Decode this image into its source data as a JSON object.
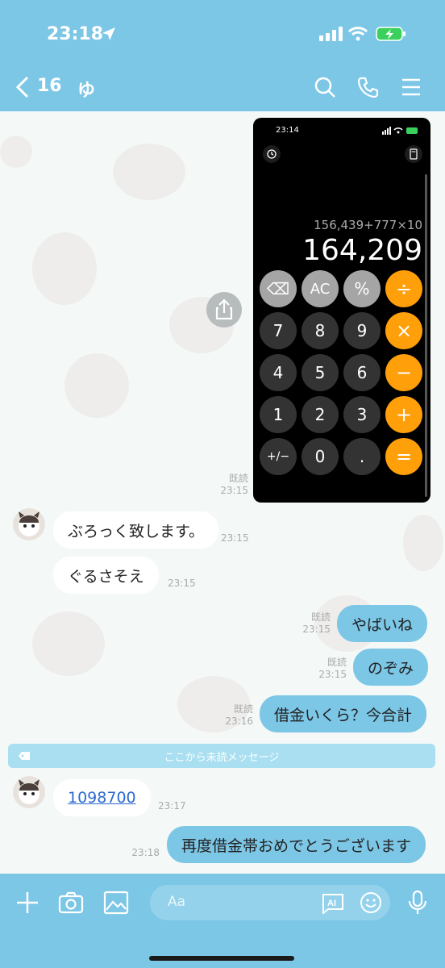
{
  "status": {
    "time": "23:18"
  },
  "header": {
    "unread_count": "16",
    "contact_name": "ゆ"
  },
  "calculator_screenshot": {
    "time": "23:14",
    "expression": "156,439+777×10",
    "result": "164,209",
    "keys": [
      "⌫",
      "AC",
      "%",
      "÷",
      "7",
      "8",
      "9",
      "×",
      "4",
      "5",
      "6",
      "−",
      "1",
      "2",
      "3",
      "+",
      "+/−",
      "0",
      ".",
      "="
    ]
  },
  "calculator_meta": {
    "read": "既読",
    "time": "23:15"
  },
  "messages": [
    {
      "side": "in",
      "text": "ぶろっく致します。",
      "time": "23:15"
    },
    {
      "side": "in",
      "text": "ぐるさそえ",
      "time": "23:15"
    },
    {
      "side": "out",
      "text": "やばいね",
      "read": "既読",
      "time": "23:15"
    },
    {
      "side": "out",
      "text": "のぞみ",
      "read": "既読",
      "time": "23:15"
    },
    {
      "side": "out",
      "text": "借金いくら？今合計",
      "read": "既読",
      "time": "23:16"
    },
    {
      "side": "in",
      "text": "1098700",
      "time": "23:17"
    },
    {
      "side": "out",
      "text": "再度借金帯おめでとうございます",
      "time": "23:18"
    }
  ],
  "unread_divider": "ここから未読メッセージ",
  "input": {
    "placeholder": "Aa"
  },
  "colors": {
    "accent": "#7cc6e6",
    "orange": "#ff9f0a",
    "link": "#2c6ad1"
  }
}
